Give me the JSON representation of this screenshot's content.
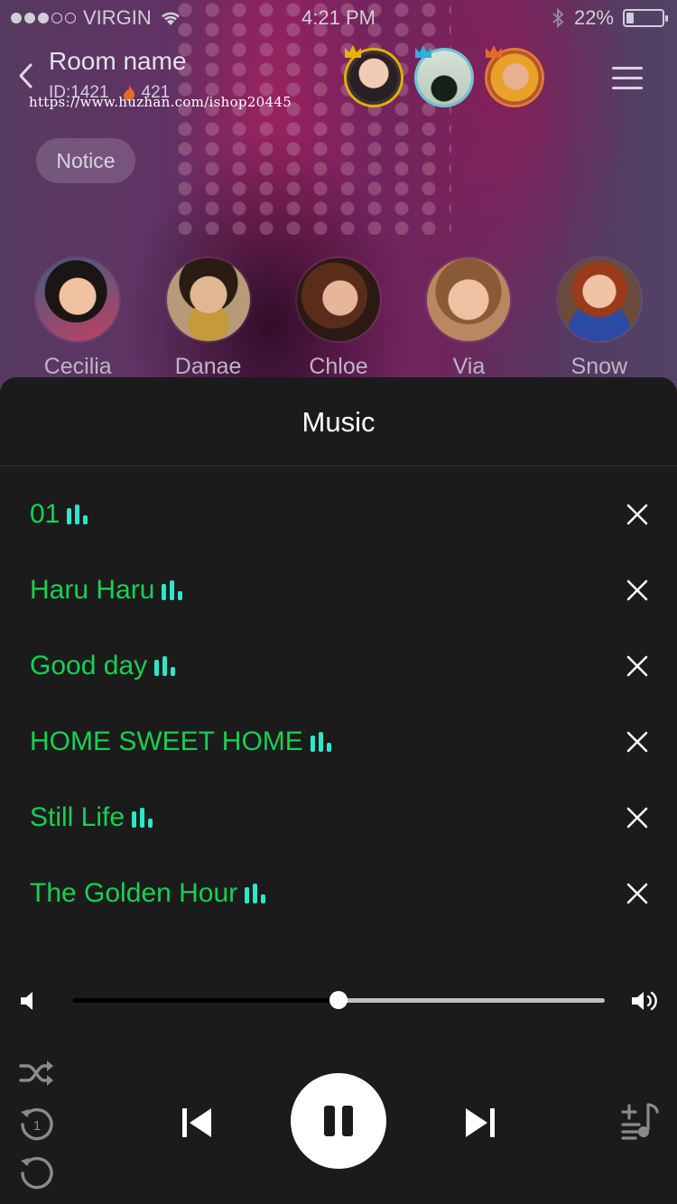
{
  "status_bar": {
    "carrier": "VIRGIN",
    "time": "4:21 PM",
    "battery": "22%",
    "battery_level": 0.22
  },
  "room": {
    "name": "Room name",
    "id_label": "ID:1421",
    "heat": "421",
    "notice_label": "Notice"
  },
  "watermark": "https://www.huzhan.com/ishop20445",
  "top_users": [
    {
      "crown_color": "#e8b400",
      "ring": "#e0b100"
    },
    {
      "crown_color": "#2bb3d8",
      "ring": "#6bc6d6"
    },
    {
      "crown_color": "#e46a2a",
      "ring": "#e07b36"
    }
  ],
  "seats": [
    {
      "name": "Cecilia"
    },
    {
      "name": "Danae"
    },
    {
      "name": "Chloe"
    },
    {
      "name": "Via"
    },
    {
      "name": "Snow"
    }
  ],
  "music": {
    "title": "Music",
    "songs": [
      {
        "title": "01"
      },
      {
        "title": "Haru Haru"
      },
      {
        "title": "Good day"
      },
      {
        "title": "HOME SWEET HOME"
      },
      {
        "title": "Still Life"
      },
      {
        "title": "The Golden Hour"
      }
    ],
    "volume_level": 0.5
  },
  "colors": {
    "accent": "#17d052",
    "equalizer": "#2ee6c8",
    "sheet_bg": "#1b1b1c"
  }
}
